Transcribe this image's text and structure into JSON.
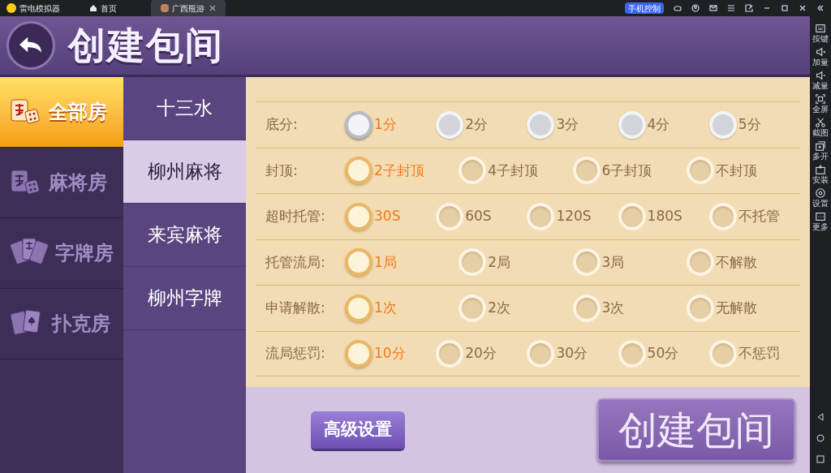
{
  "emulator": {
    "app_name": "雷电模拟器",
    "tabs": [
      {
        "label": "首页",
        "kind": "home",
        "selected": false
      },
      {
        "label": "广西瓶游",
        "kind": "app",
        "selected": true
      }
    ],
    "phone_control": "手机控制",
    "sidebar": [
      "按键",
      "加量",
      "减量",
      "全屏",
      "截图",
      "多开",
      "安装",
      "设置",
      "更多"
    ]
  },
  "header": {
    "title": "创建包间"
  },
  "categories": [
    {
      "label": "全部房",
      "kind": "mahjong",
      "selected": true
    },
    {
      "label": "麻将房",
      "kind": "mahjong",
      "selected": false
    },
    {
      "label": "字牌房",
      "kind": "cards",
      "selected": false
    },
    {
      "label": "扑克房",
      "kind": "poker",
      "selected": false
    }
  ],
  "games": [
    {
      "label": "十三水",
      "selected": false
    },
    {
      "label": "柳州麻将",
      "selected": true
    },
    {
      "label": "来宾麻将",
      "selected": false
    },
    {
      "label": "柳州字牌",
      "selected": false
    }
  ],
  "settings": [
    {
      "label": "底分:",
      "kind": "silver",
      "options": [
        {
          "label": "1分",
          "selected": true
        },
        {
          "label": "2分",
          "selected": false
        },
        {
          "label": "3分",
          "selected": false
        },
        {
          "label": "4分",
          "selected": false
        },
        {
          "label": "5分",
          "selected": false
        }
      ]
    },
    {
      "label": "封顶:",
      "kind": "gold",
      "options": [
        {
          "label": "2子封顶",
          "selected": true
        },
        {
          "label": "4子封顶",
          "selected": false
        },
        {
          "label": "6子封顶",
          "selected": false
        },
        {
          "label": "不封顶",
          "selected": false
        }
      ]
    },
    {
      "label": "超时托管:",
      "kind": "gold",
      "options": [
        {
          "label": "30S",
          "selected": true
        },
        {
          "label": "60S",
          "selected": false
        },
        {
          "label": "120S",
          "selected": false
        },
        {
          "label": "180S",
          "selected": false
        },
        {
          "label": "不托管",
          "selected": false
        }
      ]
    },
    {
      "label": "托管流局:",
      "kind": "gold",
      "options": [
        {
          "label": "1局",
          "selected": true
        },
        {
          "label": "2局",
          "selected": false
        },
        {
          "label": "3局",
          "selected": false
        },
        {
          "label": "不解散",
          "selected": false
        }
      ]
    },
    {
      "label": "申请解散:",
      "kind": "gold",
      "options": [
        {
          "label": "1次",
          "selected": true
        },
        {
          "label": "2次",
          "selected": false
        },
        {
          "label": "3次",
          "selected": false
        },
        {
          "label": "无解散",
          "selected": false
        }
      ]
    },
    {
      "label": "流局惩罚:",
      "kind": "gold",
      "options": [
        {
          "label": "10分",
          "selected": true
        },
        {
          "label": "20分",
          "selected": false
        },
        {
          "label": "30分",
          "selected": false
        },
        {
          "label": "50分",
          "selected": false
        },
        {
          "label": "不惩罚",
          "selected": false
        }
      ]
    }
  ],
  "advanced_button": "高级设置",
  "create_button": "创建包间"
}
